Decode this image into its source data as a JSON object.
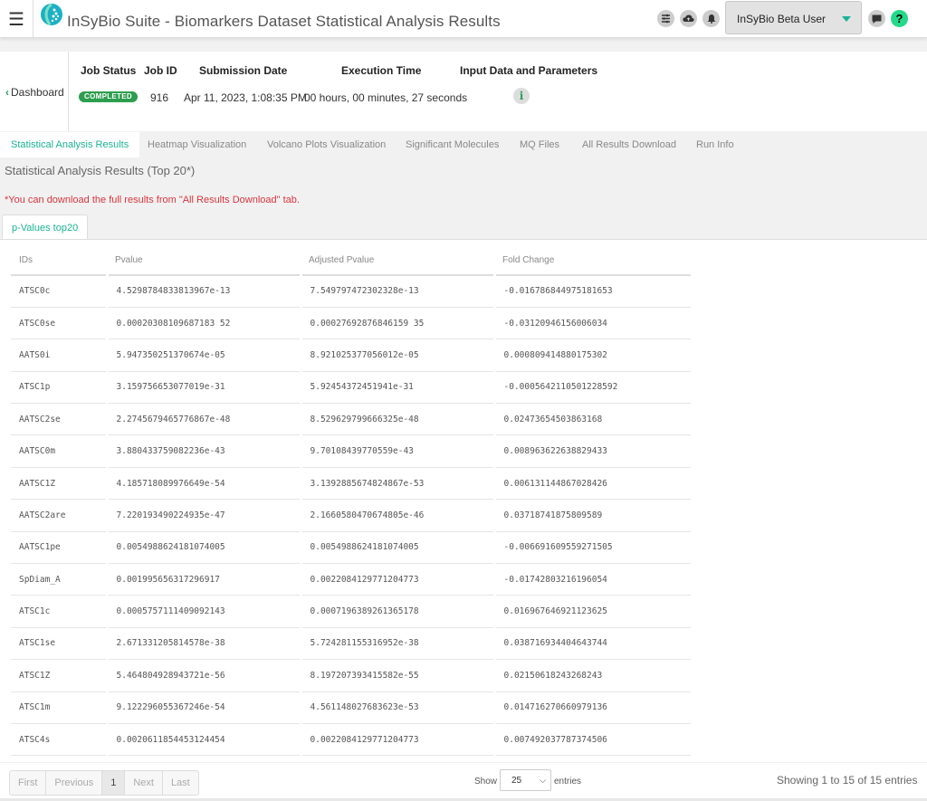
{
  "topbar": {
    "title": "InSyBio Suite - Biomarkers Dataset Statistical Analysis Results",
    "user": "InSyBio Beta User",
    "icons": [
      "menu-icon",
      "sliders-icon",
      "cloud-upload-icon",
      "bell-icon",
      "chat-icon",
      "help-icon"
    ],
    "help_glyph": "?"
  },
  "job": {
    "back_label": "Dashboard",
    "headers": {
      "status": "Job Status",
      "id": "Job ID",
      "date": "Submission Date",
      "time": "Execution Time",
      "input": "Input Data and Parameters"
    },
    "status": "COMPLETED",
    "id": "916",
    "date": "Apr 11, 2023, 1:08:35 PM",
    "time": "00 hours, 00 minutes, 27 seconds",
    "status_color": "#2d9e4f"
  },
  "tabs": [
    "Statistical Analysis Results",
    "Heatmap Visualization",
    "Volcano Plots Visualization",
    "Significant Molecules",
    "MQ Files",
    "All Results Download",
    "Run Info"
  ],
  "section_title": "Statistical Analysis Results (Top 20*)",
  "note": "*You can download the full results from \"All Results Download\" tab.",
  "subtab": "p-Values top20",
  "table": {
    "headers": [
      "IDs",
      "Pvalue",
      "Adjusted Pvalue",
      "Fold Change"
    ],
    "rows": [
      [
        "ATSC0c",
        "4.5298784833813967e-13",
        "7.549797472302328e-13",
        "-0.016786844975181653"
      ],
      [
        "ATSC0se",
        "0.00020308109687183 52",
        "0.00027692876846159 35",
        "-0.03120946156006034"
      ],
      [
        "AATS0i",
        "5.947350251370674e-05",
        "8.921025377056012e-05",
        "0.000809414880175302"
      ],
      [
        "ATSC1p",
        "3.159756653077019e-31",
        "5.92454372451941e-31",
        "-0.0005642110501228592"
      ],
      [
        "AATSC2se",
        "2.2745679465776867e-48",
        "8.529629799666325e-48",
        "0.02473654503863168"
      ],
      [
        "AATSC0m",
        "3.880433759082236e-43",
        "9.70108439770559e-43",
        "0.008963622638829433"
      ],
      [
        "AATSC1Z",
        "4.185718089976649e-54",
        "3.1392885674824867e-53",
        "0.006131144867028426"
      ],
      [
        "AATSC2are",
        "7.220193490224935e-47",
        "2.1660580470674805e-46",
        "0.03718741875809589"
      ],
      [
        "AATSC1pe",
        "0.0054988624181074005",
        "0.0054988624181074005",
        "-0.006691609559271505"
      ],
      [
        "SpDiam_A",
        "0.001995656317296917",
        "0.0022084129771204773",
        "-0.01742803216196054"
      ],
      [
        "ATSC1c",
        "0.0005757111409092143",
        "0.0007196389261365178",
        "0.016967646921123625"
      ],
      [
        "ATSC1se",
        "2.671331205814578e-38",
        "5.724281155316952e-38",
        "0.038716934404643744"
      ],
      [
        "ATSC1Z",
        "5.464804928943721e-56",
        "8.197207393415582e-55",
        "0.02150618243268243"
      ],
      [
        "ATSC1m",
        "9.122296055367246e-54",
        "4.561148027683623e-53",
        "0.014716270660979136"
      ],
      [
        "ATSC4s",
        "0.0020611854453124454",
        "0.0022084129771204773",
        "0.007492037787374506"
      ]
    ]
  },
  "pagination": {
    "first": "First",
    "previous": "Previous",
    "current": "1",
    "next": "Next",
    "last": "Last",
    "show_label": "Show",
    "page_length": "25",
    "entries_label": "entries",
    "info": "Showing 1 to 15 of 15 entries"
  }
}
